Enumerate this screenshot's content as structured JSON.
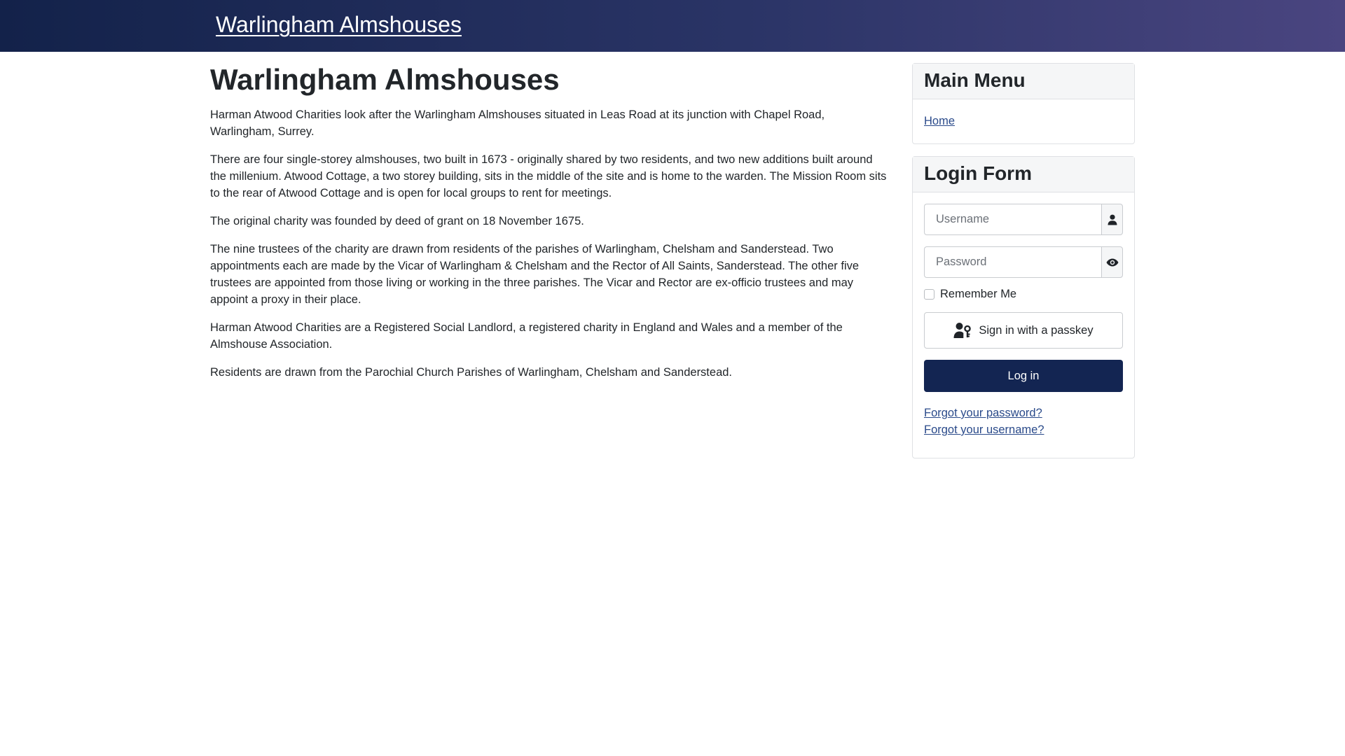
{
  "header": {
    "site_title": "Warlingham Almshouses"
  },
  "main": {
    "title": "Warlingham Almshouses",
    "paragraphs": [
      "Harman Atwood Charities look after the Warlingham Almshouses situated in Leas Road at its junction with Chapel Road, Warlingham, Surrey.",
      "There are four single-storey almshouses, two built in 1673 - originally shared by two residents, and two new additions built around the millenium. Atwood Cottage, a two storey building, sits in the middle of the site and is home to the warden. The Mission Room sits to the rear of Atwood Cottage and is open for local groups to rent for meetings.",
      "The original charity was founded by deed of grant on 18 November 1675.",
      "The nine trustees of the charity are drawn from residents of the parishes of Warlingham, Chelsham and Sanderstead. Two appointments each are made by the Vicar of Warlingham & Chelsham and the Rector of All Saints, Sanderstead. The other five trustees are appointed from those living or working in the three parishes. The Vicar and Rector are ex-officio trustees and may appoint a proxy in their place.",
      "Harman Atwood Charities are a Registered Social Landlord, a registered charity in England and Wales and a member of the Almshouse Association.",
      "Residents are drawn from the Parochial Church Parishes of Warlingham, Chelsham and Sanderstead."
    ]
  },
  "sidebar": {
    "main_menu": {
      "title": "Main Menu",
      "items": [
        {
          "label": "Home"
        }
      ]
    },
    "login_form": {
      "title": "Login Form",
      "username_placeholder": "Username",
      "username_value": "",
      "password_placeholder": "Password",
      "password_value": "",
      "remember_label": "Remember Me",
      "remember_checked": false,
      "passkey_label": "Sign in with a passkey",
      "login_label": "Log in",
      "forgot_password": "Forgot your password?",
      "forgot_username": "Forgot your username?"
    }
  },
  "icons": {
    "username_addon": "user-icon",
    "password_addon": "eye-icon",
    "passkey": "user-key-icon"
  },
  "colors": {
    "header_gradient_start": "#13224a",
    "header_gradient_end": "#4a4580",
    "primary_button": "#132552",
    "link": "#2a4a8a"
  }
}
